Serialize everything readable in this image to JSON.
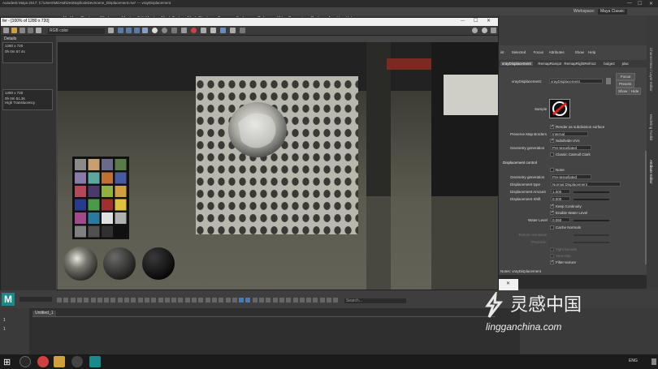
{
  "window": {
    "title": "Autodesk Maya 2017: C:\\Users\\MDAM\\Desktop\\lookDevScene_Displacement.ma* --- vrayDisplacement",
    "workspace_label": "Workspace:",
    "workspace_value": "Maya Classic"
  },
  "menus": [
    "File",
    "Edit",
    "Create",
    "Select",
    "Modify",
    "Display",
    "Windows",
    "Mesh",
    "Edit Mesh",
    "Mesh Tools",
    "Mesh Display",
    "Curves",
    "Surfaces",
    "Deform",
    "UV",
    "Generate",
    "Cache",
    "Arnold",
    "Help"
  ],
  "render_view": {
    "title": "fer - [100% of 1280 x 720]",
    "channel_option": "RGB color",
    "info_panel_title": "Details",
    "info_block_1": [
      "1280 x 720",
      "0h 0m 57.4s"
    ],
    "info_block_2": [
      "1280 x 720",
      "0h 0m 51.3s",
      "High Translucency"
    ]
  },
  "attribute_editor": {
    "menu": [
      "ist",
      "Selected",
      "Focus",
      "Attributes",
      "Show",
      "Help"
    ],
    "tabs": [
      "vrayDisplacement",
      "RemapRamp2",
      "RemapRightRefrix2",
      "bulge2",
      "plac"
    ],
    "node_label": "vrayDisplacement:",
    "node_value": "vrayDisplacement",
    "focus_btn": "Focus",
    "presets_btn": "Presets",
    "show_btn": "Show",
    "hide_btn": "Hide",
    "sample_label": "Sample",
    "render_subdiv": "Render as subdivision surface",
    "preserve_map_borders_label": "Preserve Map Borders",
    "preserve_map_borders_value": "Internal",
    "subdivide_uvs": "Subdivide UVs",
    "geometry_generation_label": "Geometry generation",
    "geometry_generation_value": "Pre-tessellated",
    "classic_catmull": "Classic Catmull Clark",
    "section_displacement": "Displacement control",
    "none_label": "None",
    "geometry_generation2_label": "Geometry generation",
    "geometry_generation2_value": "Pre-tessellated",
    "displacement_type_label": "Displacement type",
    "displacement_type_value": "Normal Displacement",
    "displacement_amount_label": "Displacement Amount",
    "displacement_amount_value": "1.000",
    "displacement_shift_label": "Displacement Shift",
    "displacement_shift_value": "0.000",
    "keep_continuity": "Keep Continuity",
    "enable_water_level": "Enable Water Level",
    "water_level_label": "Water Level",
    "water_level_value": "0.050",
    "cache_normals": "Cache Normals",
    "texture_resolution_label": "Texture resolution",
    "precision_label": "Precision",
    "tight_bounds": "Tight bounds",
    "view_dep": "View-dep",
    "filter_texture": "Filter texture",
    "notes_label": "Notes: vrayDisplacement"
  },
  "right_tabs": [
    "Channel Box / Layer Editor",
    "Modeling Toolkit",
    "Attribute Editor"
  ],
  "timeline": {
    "tab": "Untitled_1",
    "search_placeholder": "Search...",
    "frame_a": "1",
    "frame_b": "1"
  },
  "taskbar": {
    "lang": "ENG",
    "watermark_cn": "灵感中国",
    "watermark_url": "lingganchina.com"
  },
  "colors": {
    "accent_blue": "#4a90d9",
    "maya_teal": "#2aa198",
    "checker_colors": [
      "#8a8a8a",
      "#c8a070",
      "#6a6a8a",
      "#5a7a4a",
      "#8a7aa8",
      "#5aa8a0",
      "#c07030",
      "#4a5aa0",
      "#b04a5a",
      "#4a3a6a",
      "#90b040",
      "#d0a040",
      "#2a3a8a",
      "#4a9a4a",
      "#a03030",
      "#e0c040",
      "#a04a8a",
      "#2a7aa0",
      "#e0e0e0",
      "#b0b0b0",
      "#808080",
      "#505050",
      "#303030",
      "#101010"
    ]
  }
}
